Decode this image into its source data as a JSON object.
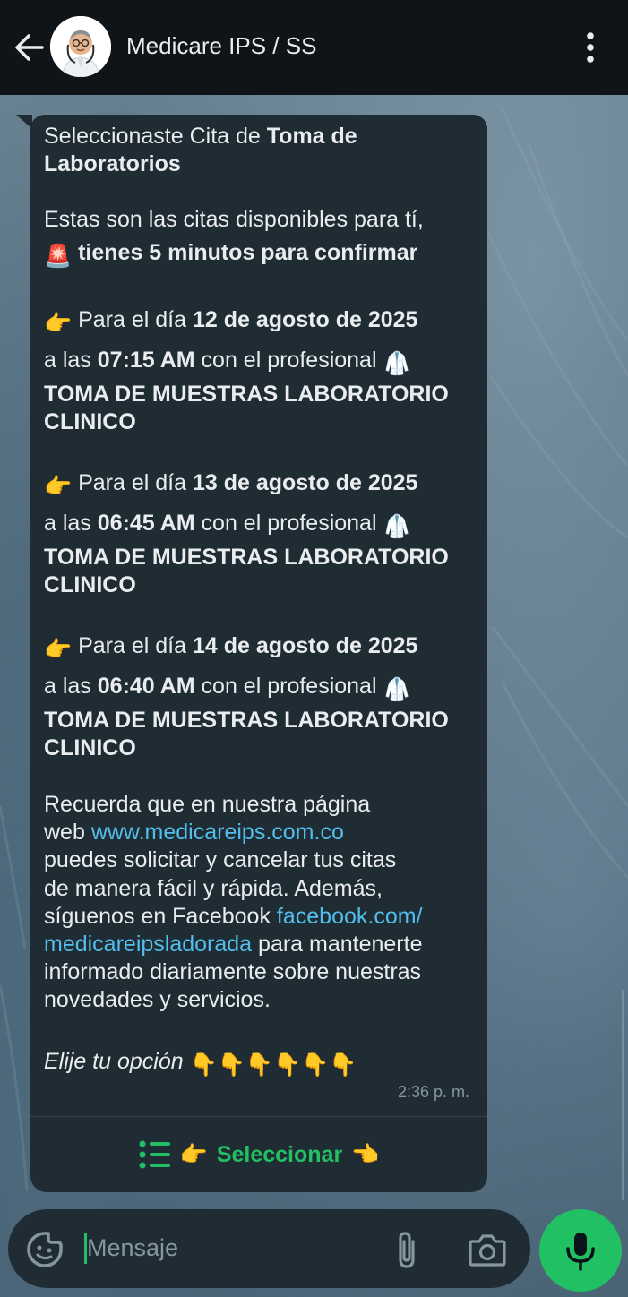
{
  "header": {
    "title": "Medicare IPS / SS",
    "back_icon": "arrow-left-icon",
    "menu_icon": "more-vertical-icon"
  },
  "message": {
    "line1_normal": "Seleccionaste Cita de ",
    "line1_bold": "Toma de",
    "line2_bold": "Laboratorios",
    "avail_line": "Estas son las citas disponibles para tí,",
    "warning_emoji": "🚨",
    "warning_text": "tienes 5 minutos para confirmar",
    "appointments": [
      {
        "pointer": "👉",
        "day_prefix": "Para el día ",
        "date": "12 de agosto de 2025",
        "time_prefix": "a las ",
        "time": "07:15 AM",
        "time_suffix": " con el profesional ",
        "coat": "🥼",
        "prof_line1": "TOMA DE MUESTRAS LABORATORIO",
        "prof_line2": "CLINICO"
      },
      {
        "pointer": "👉",
        "day_prefix": "Para el día ",
        "date": "13 de agosto de 2025",
        "time_prefix": "a las ",
        "time": "06:45 AM",
        "time_suffix": " con el profesional ",
        "coat": "🥼",
        "prof_line1": "TOMA DE MUESTRAS LABORATORIO",
        "prof_line2": "CLINICO"
      },
      {
        "pointer": "👉",
        "day_prefix": "Para el día ",
        "date": "14 de agosto de 2025",
        "time_prefix": "a las ",
        "time": "06:40 AM",
        "time_suffix": " con el profesional ",
        "coat": "🥼",
        "prof_line1": "TOMA DE MUESTRAS LABORATORIO",
        "prof_line2": "CLINICO"
      }
    ],
    "footer_lines": {
      "l1": "Recuerda que en nuestra página",
      "l2_prefix": "web ",
      "l2_link": "www.medicareips.com.co",
      "l3": "puedes solicitar y cancelar tus citas",
      "l4": "de manera fácil y rápida. Además,",
      "l5_prefix": "síguenos en Facebook ",
      "l5_link": "facebook.com/",
      "l6_link": "medicareipsladorada",
      "l6_suffix": " para mantenerte",
      "l7": "informado diariamente sobre nuestras",
      "l8": "novedades y servicios."
    },
    "choose_text": "Elije tu opción",
    "choose_emojis": "👇👇👇👇👇👇",
    "timestamp": "2:36 p. m.",
    "select_left": "👉",
    "select_label": "Seleccionar",
    "select_right": "👈"
  },
  "input": {
    "placeholder": "Mensaje",
    "sticker_icon": "sticker-icon",
    "attach_icon": "paperclip-icon",
    "camera_icon": "camera-icon",
    "mic_icon": "microphone-icon"
  },
  "colors": {
    "header_bg": "#0f1419",
    "bubble_bg": "#1f2c33",
    "accent_green": "#21c063",
    "link": "#53bdeb"
  }
}
